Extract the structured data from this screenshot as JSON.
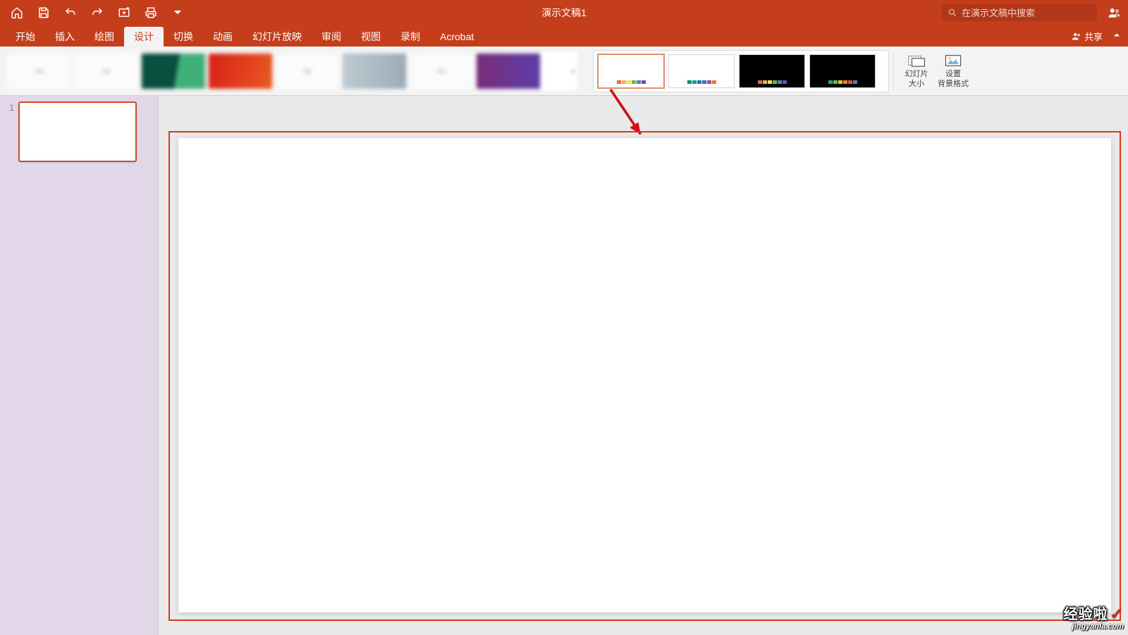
{
  "titlebar": {
    "doc_title": "演示文稿1",
    "search_placeholder": "在演示文稿中搜索"
  },
  "tabs": {
    "items": [
      {
        "label": "开始"
      },
      {
        "label": "插入"
      },
      {
        "label": "绘图"
      },
      {
        "label": "设计"
      },
      {
        "label": "切换"
      },
      {
        "label": "动画"
      },
      {
        "label": "幻灯片放映"
      },
      {
        "label": "审阅"
      },
      {
        "label": "视图"
      },
      {
        "label": "录制"
      },
      {
        "label": "Acrobat"
      }
    ],
    "active_index": 3,
    "share_label": "共享"
  },
  "ribbon": {
    "slide_size_line1": "幻灯片",
    "slide_size_line2": "大小",
    "format_bg_line1": "设置",
    "format_bg_line2": "背景格式",
    "variant_colors": {
      "v1": [
        "#e06b4a",
        "#f0b050",
        "#f0e050",
        "#70b050",
        "#5080c0",
        "#7050a0"
      ],
      "v2": [
        "#008a6e",
        "#00a0a0",
        "#0080c0",
        "#5060c0",
        "#9050b0",
        "#f07030"
      ],
      "v3": [
        "#e06b4a",
        "#f0b050",
        "#f0e050",
        "#70b050",
        "#5080c0",
        "#7050a0"
      ],
      "v4": [
        "#30a070",
        "#60c040",
        "#f0c030",
        "#f08030",
        "#e05030",
        "#5080c0"
      ]
    }
  },
  "slides": {
    "items": [
      {
        "num": "1"
      }
    ]
  },
  "watermark": {
    "brand": "经验啦",
    "url": "jingyanla.com"
  }
}
